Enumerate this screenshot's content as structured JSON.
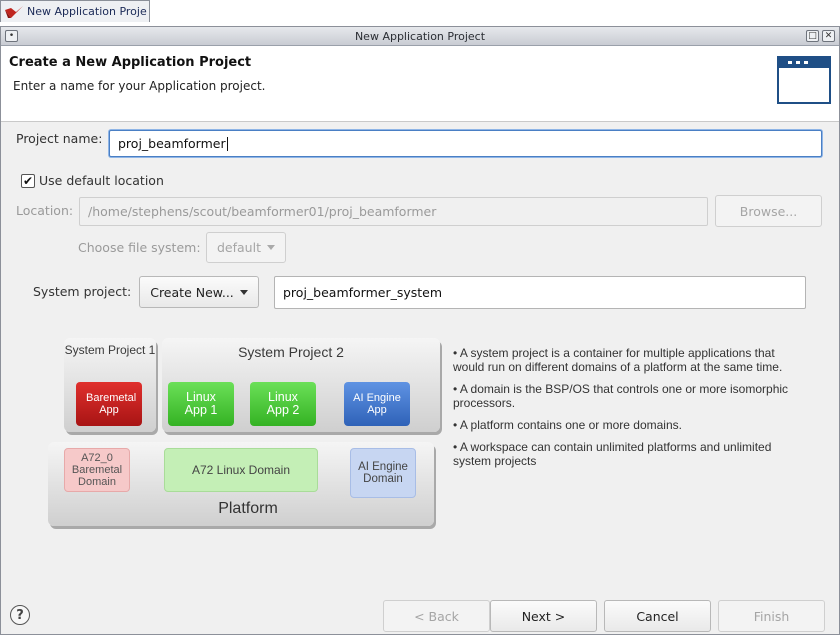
{
  "taskbar": {
    "tab_label": "New Application Proje"
  },
  "window": {
    "title": "New Application Project"
  },
  "header": {
    "title": "Create a New Application Project",
    "description": "Enter a name for your Application project."
  },
  "form": {
    "project_name_label": "Project name:",
    "project_name_value": "proj_beamformer",
    "use_default_location_label": "Use default location",
    "use_default_location_checked": true,
    "location_label": "Location:",
    "location_value": "/home/stephens/scout/beamformer01/proj_beamformer",
    "browse_label": "Browse...",
    "file_system_label": "Choose file system:",
    "file_system_value": "default",
    "system_project_label": "System project:",
    "system_project_mode": "Create New...",
    "system_project_name": "proj_beamformer_system"
  },
  "diagram": {
    "system_project_1": "System Project 1",
    "system_project_2": "System Project 2",
    "baremetal_app": "Baremetal App",
    "linux_app_1": "Linux App 1",
    "linux_app_2": "Linux App 2",
    "ai_engine_app": "AI Engine App",
    "a72_baremetal_domain": "A72_0 Baremetal Domain",
    "a72_linux_domain": "A72 Linux Domain",
    "ai_engine_domain": "AI Engine Domain",
    "platform": "Platform"
  },
  "bullets": [
    "• A system project is a container for multiple applications that would run on different domains of a platform at the same time.",
    "• A domain is the BSP/OS that controls one or more isomorphic processors.",
    "• A platform contains one or more domains.",
    "• A workspace can contain unlimited platforms and unlimited system projects"
  ],
  "buttons": {
    "help": "?",
    "back": "< Back",
    "next": "Next >",
    "cancel": "Cancel",
    "finish": "Finish"
  },
  "colors": {
    "accent_focus": "#4a7fc4",
    "baremetal_red": "#c8201f",
    "linux_green": "#4fcf3a",
    "ai_engine_blue": "#3f78d0"
  }
}
